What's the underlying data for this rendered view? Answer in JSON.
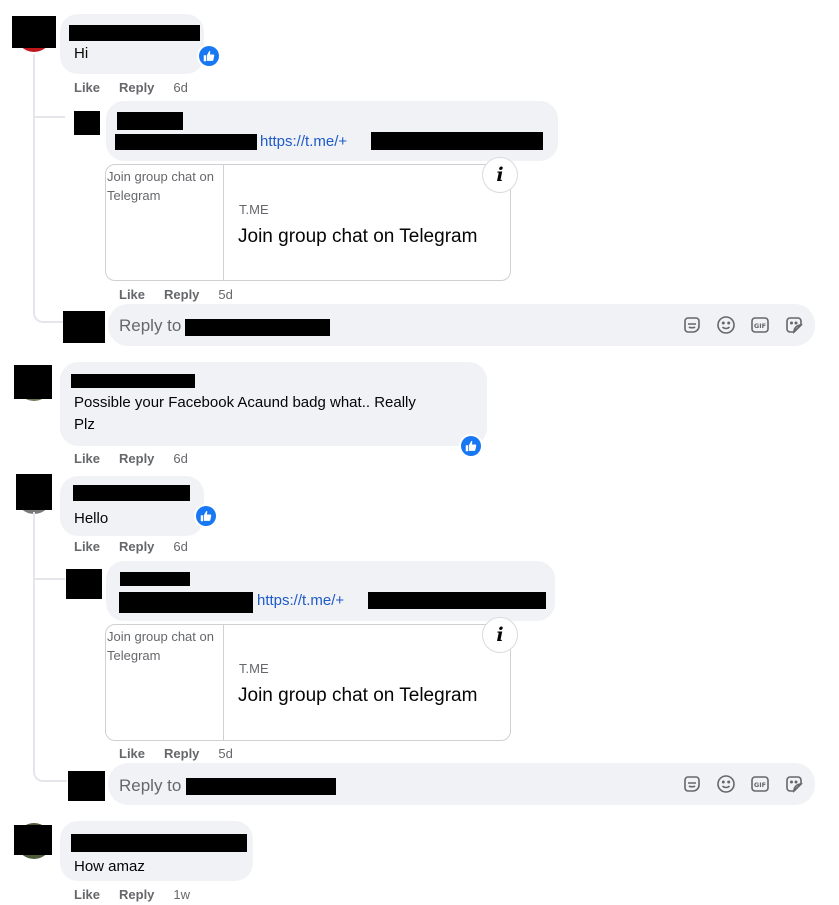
{
  "comments": [
    {
      "text": "Hi",
      "actions": {
        "like": "Like",
        "reply": "Reply",
        "time": "6d"
      },
      "reaction": "like-icon"
    },
    {
      "text": "Possible your Facebook Acaund badg what.. Really",
      "text_line2": "Plz",
      "actions": {
        "like": "Like",
        "reply": "Reply",
        "time": "6d"
      },
      "reaction": "like-icon"
    },
    {
      "text": "Hello",
      "actions": {
        "like": "Like",
        "reply": "Reply",
        "time": "6d"
      },
      "reaction": "like-icon"
    },
    {
      "text": "How amaz",
      "actions": {
        "like": "Like",
        "reply": "Reply",
        "time": "1w"
      }
    }
  ],
  "replies": [
    {
      "link": "https://t.me/+",
      "card": {
        "image_alt": "Join group chat on Telegram",
        "domain": "T.ME",
        "title": "Join group chat on Telegram",
        "info_label": "i"
      },
      "actions": {
        "like": "Like",
        "reply": "Reply",
        "time": "5d"
      }
    },
    {
      "link": "https://t.me/+",
      "card": {
        "image_alt": "Join group chat on Telegram",
        "domain": "T.ME",
        "title": "Join group chat on Telegram",
        "info_label": "i"
      },
      "actions": {
        "like": "Like",
        "reply": "Reply",
        "time": "5d"
      }
    }
  ],
  "reply_boxes": [
    {
      "placeholder": "Reply to"
    },
    {
      "placeholder": "Reply to"
    }
  ],
  "composer_tools": [
    "avatar-sticker-icon",
    "emoji-icon",
    "gif-icon",
    "sticker-icon"
  ],
  "colors": {
    "bubble": "#f0f2f5",
    "link": "#1e5ac8",
    "like_badge": "#1877f2",
    "muted": "#65676b"
  }
}
